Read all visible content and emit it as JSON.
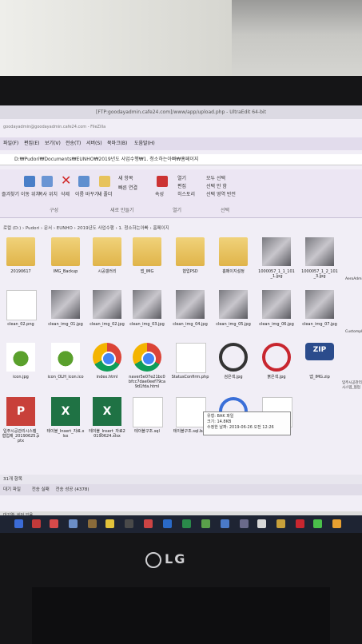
{
  "window_title": "[FTP:goodayadmin.cafe24.com]/www/app/upload.php - UltraEdit 64-bit",
  "explorer_title_ids": "goodayadmin@goodayadmin.cafe24.com - FileZilla",
  "address_bar": "D:₩Pudori₩Documents₩EUNHO₩2019년도 사업수행₩1. 청소하는아빠₩홈페이지",
  "breadcrumb": "로컬 (D:) › Pudori › 문서 › EUNHO › 2019년도 사업수행 › 1. 청소하는아빠 › 홈페이지",
  "ribbon": {
    "tabs": [
      "파일(F)",
      "편집(E)",
      "보기(V)",
      "전송(T)",
      "서버(S)",
      "북마크(B)",
      "도움말(H)"
    ],
    "buttons": [
      "이동 위치",
      "복사 위치",
      "삭제",
      "이름 바꾸기",
      "새 폴더",
      "새 항목",
      "빠른 연결",
      "속성",
      "열기",
      "편집",
      "히스토리",
      "모두 선택",
      "선택 안 함",
      "선택 영역 반전"
    ],
    "groups": [
      "구성",
      "새로 만들기",
      "열기",
      "선택"
    ],
    "left_label": "즐겨찾기"
  },
  "files": [
    {
      "name": "20190617",
      "kind": "folder"
    },
    {
      "name": "IMG_Backup",
      "kind": "folder"
    },
    {
      "name": "시공갤러리",
      "kind": "folder"
    },
    {
      "name": "앱_IMG",
      "kind": "folder"
    },
    {
      "name": "협업PSD",
      "kind": "folder"
    },
    {
      "name": "홈페이지설정",
      "kind": "folder"
    },
    {
      "name": "1000057_1_1_101_1.jpg",
      "kind": "photo"
    },
    {
      "name": "1000057_1_2_101_3.jpg",
      "kind": "photo"
    },
    {
      "name": "clean_02.png",
      "kind": "doc"
    },
    {
      "name": "clean_img_01.jpg",
      "kind": "photo"
    },
    {
      "name": "clean_img_02.jpg",
      "kind": "photo"
    },
    {
      "name": "clean_img_03.jpg",
      "kind": "photo"
    },
    {
      "name": "clean_img_04.jpg",
      "kind": "photo"
    },
    {
      "name": "clean_img_05.jpg",
      "kind": "photo"
    },
    {
      "name": "clean_img_06.jpg",
      "kind": "photo"
    },
    {
      "name": "clean_img_07.jpg",
      "kind": "photo"
    },
    {
      "name": "icon.jpg",
      "kind": "leaf"
    },
    {
      "name": "icon_OLH_icon.ico",
      "kind": "leaf"
    },
    {
      "name": "index.html",
      "kind": "chrome"
    },
    {
      "name": "naver5e07e21bc0bfcc7dae0eef79ca9d1fda.html",
      "kind": "chrome"
    },
    {
      "name": "StatusConfirm.php",
      "kind": "doc"
    },
    {
      "name": "검은색.jpg",
      "kind": "ring-dark"
    },
    {
      "name": "붉은색.jpg",
      "kind": "ring-red"
    },
    {
      "name": "앱_IMG.zip",
      "kind": "zip"
    },
    {
      "name": "입주시공관리시스템_협업제_20190625.pptx",
      "kind": "ppt"
    },
    {
      "name": "테이블_Insert_자료.xlsx",
      "kind": "xls"
    },
    {
      "name": "테이블_Insert_자료20190624.xlsx",
      "kind": "xls"
    },
    {
      "name": "테이블구조.sql",
      "kind": "doc"
    },
    {
      "name": "테이블구조.sql.bak",
      "kind": "doc"
    },
    {
      "name": "파랑색.jpg",
      "kind": "ring-blue"
    },
    {
      "name": "행정최종평가.xls",
      "kind": "doc"
    }
  ],
  "right_column": [
    "AeroAdmin",
    "Customphp",
    "입주시공관리시스템_협업"
  ],
  "tooltip": {
    "line1": "유형: BAK 파일",
    "line2": "크기: 14.8KB",
    "line3": "수정한 날짜: 2019-06-26 오전 12:26"
  },
  "status_bar": "31개 항목",
  "transfer_tabs": [
    "대기 파일",
    "전송 실패",
    "전송 성공 (4378)"
  ],
  "filezilla_status": "대기열: 비어 있음",
  "brand": "LG",
  "accent_colors": {
    "ribbon": "#ece6f3",
    "taskbar": "#1e2433",
    "folder": "#e0b44a"
  }
}
